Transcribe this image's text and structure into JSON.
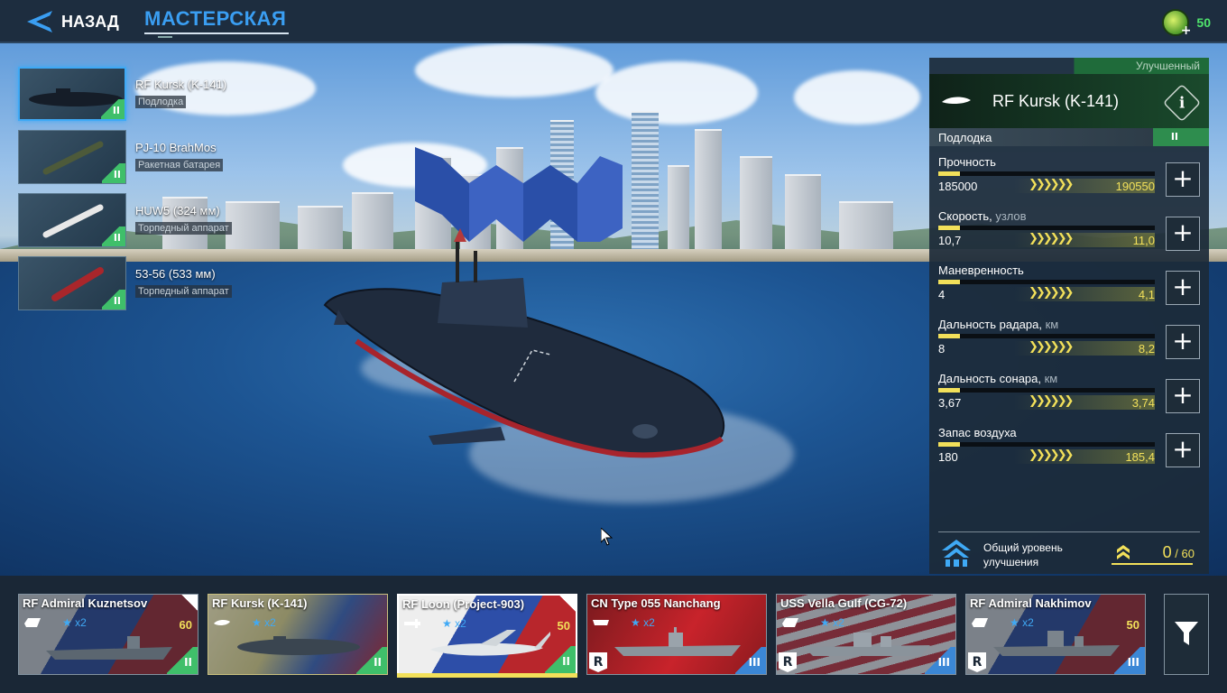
{
  "topbar": {
    "back_label": "НАЗАД",
    "tab_title": "МАСТЕРСКАЯ",
    "currency_value": "50",
    "currency_icon": "premium-coin-icon"
  },
  "weapons": [
    {
      "name": "RF Kursk (K-141)",
      "type": "Подлодка",
      "tier": "II",
      "selected": true
    },
    {
      "name": "PJ-10 BrahMos",
      "type": "Ракетная батарея",
      "tier": "II",
      "selected": false
    },
    {
      "name": "HUW5 (324 мм)",
      "type": "Торпедный аппарат",
      "tier": "II",
      "selected": false
    },
    {
      "name": "53-56 (533 мм)",
      "type": "Торпедный аппарат",
      "tier": "II",
      "selected": false
    }
  ],
  "panel": {
    "grade": "Улучшенный",
    "name": "RF Kursk (K-141)",
    "type": "Подлодка",
    "tier": "II",
    "stats": [
      {
        "label": "Прочность",
        "unit": "",
        "current": "185000",
        "upgraded": "190550",
        "fill": 0.1
      },
      {
        "label": "Скорость,",
        "unit": " узлов",
        "current": "10,7",
        "upgraded": "11,0",
        "fill": 0.1
      },
      {
        "label": "Маневренность",
        "unit": "",
        "current": "4",
        "upgraded": "4,1",
        "fill": 0.1
      },
      {
        "label": "Дальность радара,",
        "unit": " км",
        "current": "8",
        "upgraded": "8,2",
        "fill": 0.1
      },
      {
        "label": "Дальность сонара,",
        "unit": " км",
        "current": "3,67",
        "upgraded": "3,74",
        "fill": 0.1
      },
      {
        "label": "Запас воздуха",
        "unit": "",
        "current": "180",
        "upgraded": "185,4",
        "fill": 0.1
      }
    ],
    "upgrade_label": "Общий уровень улучшения",
    "upgrade_current": "0",
    "upgrade_sep": " / ",
    "upgrade_max": "60"
  },
  "dock": {
    "cards": [
      {
        "name": "RF Admiral Kuznetsov",
        "stars": "x2",
        "level": "60",
        "tier": "II",
        "flag": "ru",
        "selected": false
      },
      {
        "name": "RF Kursk (K-141)",
        "stars": "x2",
        "level": "",
        "tier": "II",
        "flag": "ru",
        "selected": false
      },
      {
        "name": "RF Loon (Project-903)",
        "stars": "x2",
        "level": "50",
        "tier": "II",
        "flag": "ru",
        "selected": true
      },
      {
        "name": "CN Type 055 Nanchang",
        "stars": "x2",
        "level": "",
        "tier": "III",
        "flag": "cn",
        "selected": false
      },
      {
        "name": "USS Vella Gulf (CG-72)",
        "stars": "x2",
        "level": "",
        "tier": "III",
        "flag": "us",
        "selected": false
      },
      {
        "name": "RF Admiral Nakhimov",
        "stars": "x2",
        "level": "50",
        "tier": "III",
        "flag": "ru",
        "selected": false
      }
    ],
    "r_badge": "R"
  },
  "colors": {
    "accent_blue": "#3a9ef2",
    "upgrade_yellow": "#f2e05a",
    "tier_green": "#3fbf6a",
    "tier_blue": "#3b87d6"
  }
}
